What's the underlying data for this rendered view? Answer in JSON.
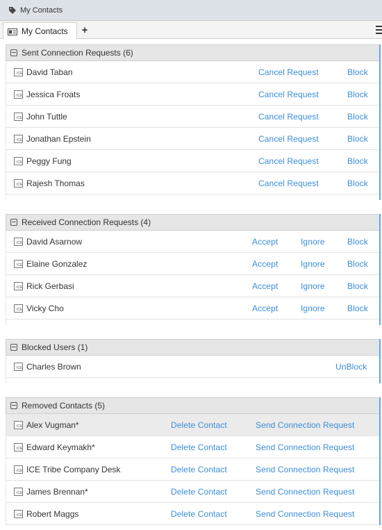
{
  "window": {
    "title": "My Contacts"
  },
  "tabs": [
    {
      "label": "My Contacts"
    }
  ],
  "sections": {
    "sent": {
      "title": "Sent Connection Requests (6)",
      "rows": [
        {
          "name": "David Taban"
        },
        {
          "name": "Jessica Froats"
        },
        {
          "name": "John Tuttle"
        },
        {
          "name": "Jonathan Epstein"
        },
        {
          "name": "Peggy Fung"
        },
        {
          "name": "Rajesh Thomas"
        }
      ],
      "actions": {
        "cancel": "Cancel Request",
        "block": "Block"
      }
    },
    "received": {
      "title": "Received Connection Requests (4)",
      "rows": [
        {
          "name": "David Asarnow"
        },
        {
          "name": "Elaine Gonzalez"
        },
        {
          "name": "Rick Gerbasi"
        },
        {
          "name": "Vicky Cho"
        }
      ],
      "actions": {
        "accept": "Accept",
        "ignore": "Ignore",
        "block": "Block"
      }
    },
    "blocked": {
      "title": "Blocked Users (1)",
      "rows": [
        {
          "name": "Charles Brown"
        }
      ],
      "actions": {
        "unblock": "UnBlock"
      }
    },
    "removed": {
      "title": "Removed Contacts (5)",
      "rows": [
        {
          "name": "Alex Vugman*"
        },
        {
          "name": "Edward Keymakh*"
        },
        {
          "name": "ICE Tribe Company Desk"
        },
        {
          "name": "James Brennan*"
        },
        {
          "name": "Robert Maggs"
        }
      ],
      "actions": {
        "delete": "Delete Contact",
        "send": "Send Connection Request"
      }
    }
  },
  "icons": {
    "row": "ice-contact-icon",
    "add_tab": "plus-icon",
    "menu": "hamburger-menu-icon"
  },
  "colors": {
    "link": "#3a8dd8",
    "accent_border": "#5aa7e6",
    "header_bg": "#e6e6e6"
  }
}
